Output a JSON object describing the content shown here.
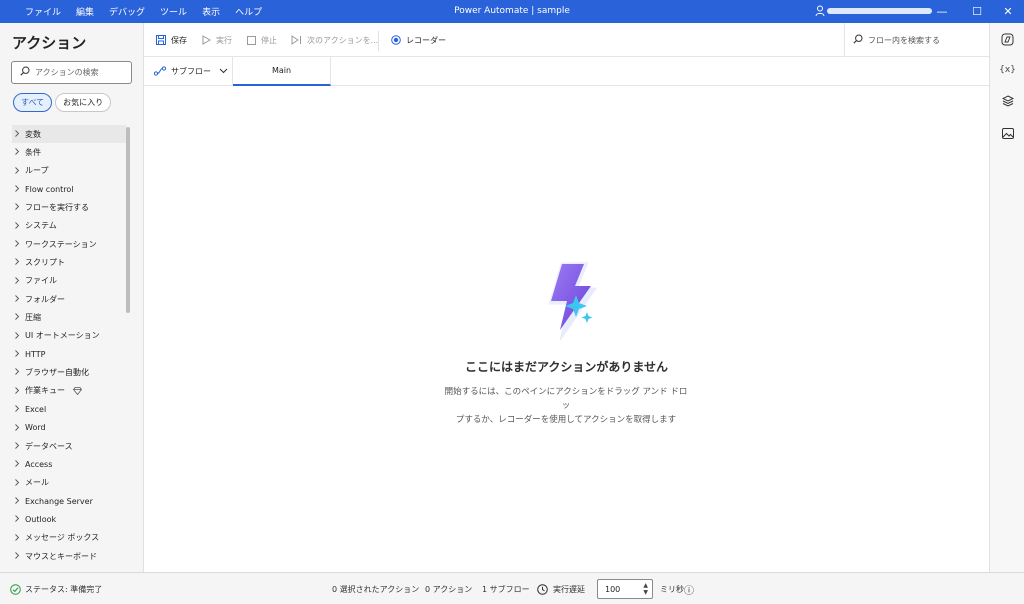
{
  "titlebar": {
    "menu": [
      "ファイル",
      "編集",
      "デバッグ",
      "ツール",
      "表示",
      "ヘルプ"
    ],
    "title": "Power Automate | sample",
    "controls": {
      "minimize": "—",
      "maximize": "☐",
      "close": "✕"
    }
  },
  "sidebar": {
    "heading": "アクション",
    "search_placeholder": "アクションの検索",
    "filters": [
      "すべて",
      "お気に入り"
    ],
    "items": [
      {
        "label": "変数"
      },
      {
        "label": "条件"
      },
      {
        "label": "ループ"
      },
      {
        "label": "Flow control"
      },
      {
        "label": "フローを実行する"
      },
      {
        "label": "システム"
      },
      {
        "label": "ワークステーション"
      },
      {
        "label": "スクリプト"
      },
      {
        "label": "ファイル"
      },
      {
        "label": "フォルダー"
      },
      {
        "label": "圧縮"
      },
      {
        "label": "UI オートメーション"
      },
      {
        "label": "HTTP"
      },
      {
        "label": "ブラウザー自動化"
      },
      {
        "label": "作業キュー"
      },
      {
        "label": "Excel"
      },
      {
        "label": "Word"
      },
      {
        "label": "データベース"
      },
      {
        "label": "Access"
      },
      {
        "label": "メール"
      },
      {
        "label": "Exchange Server"
      },
      {
        "label": "Outlook"
      },
      {
        "label": "メッセージ ボックス"
      },
      {
        "label": "マウスとキーボード"
      }
    ]
  },
  "toolbar": {
    "save": "保存",
    "run": "実行",
    "stop": "停止",
    "next_action": "次のアクションを...",
    "recorder": "レコーダー",
    "flow_search_placeholder": "フロー内を検索する"
  },
  "tabs": {
    "subflow_label": "サブフロー",
    "main_label": "Main"
  },
  "canvas": {
    "empty_title": "ここにはまだアクションがありません",
    "empty_desc_line1": "開始するには、このペインにアクションをドラッグ アンド ドロッ",
    "empty_desc_line2": "プするか、レコーダーを使用してアクションを取得します"
  },
  "rightrail": {
    "variables_label": "{x}"
  },
  "statusbar": {
    "status": "ステータス: 準備完了",
    "selected_actions": "0 選択されたアクション",
    "actions": "0 アクション",
    "subflows": "1 サブフロー",
    "delay_label": "実行遅延",
    "delay_value": "100",
    "delay_unit": "ミリ秒",
    "info_icon": "ⓘ"
  },
  "colors": {
    "accent": "#2962d9",
    "status_ok": "#2e9e46"
  }
}
